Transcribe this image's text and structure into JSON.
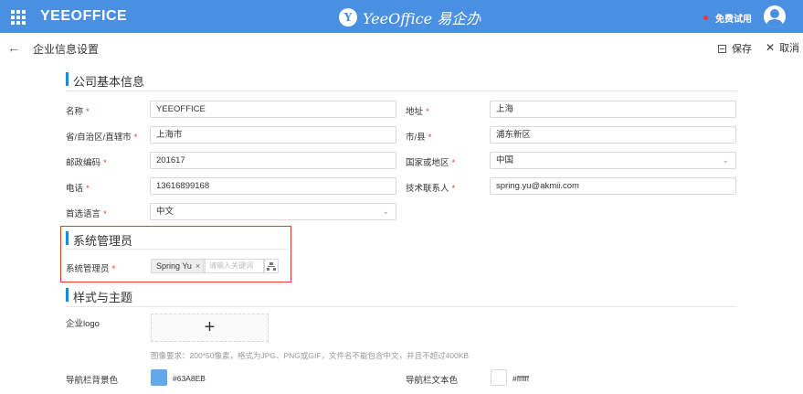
{
  "topbar": {
    "brand": "YEEOFFICE",
    "logo_mark": "Y",
    "logo_text": "YeeOffice 易企办",
    "trial": "免费试用",
    "bg_color": "#4a90e2"
  },
  "subbar": {
    "title": "企业信息设置",
    "save": "保存",
    "cancel": "取消"
  },
  "sections": {
    "basic": "公司基本信息",
    "admin": "系统管理员",
    "theme": "样式与主题"
  },
  "form": {
    "name_label": "名称",
    "name_value": "YEEOFFICE",
    "address_label": "地址",
    "address_value": "上海",
    "province_label": "省/自治区/直辖市",
    "province_value": "上海市",
    "city_label": "市/县",
    "city_value": "浦东新区",
    "zip_label": "邮政编码",
    "zip_value": "201617",
    "country_label": "国家或地区",
    "country_value": "中国",
    "phone_label": "电话",
    "phone_value": "13616899168",
    "contact_label": "技术联系人",
    "contact_value": "spring.yu@akmii.com",
    "lang_label": "首选语言",
    "lang_value": "中文",
    "required_mark": "*"
  },
  "admin": {
    "label": "系统管理员",
    "tag": "Spring Yu",
    "tag_remove": "×",
    "placeholder": "请输入关键词"
  },
  "theme": {
    "logo_label": "企业logo",
    "logo_plus": "+",
    "hint": "图像要求：200*50像素，格式为JPG、PNG或GIF，文件名不能包含中文，并且不超过400KB",
    "nav_bg_label": "导航栏背景色",
    "nav_bg_value": "#63A8EB",
    "nav_text_label": "导航栏文本色",
    "nav_text_value": "#ffffff"
  },
  "colors": {
    "accent": "#1e88e5",
    "required": "#e53935",
    "highlight": "#e53935",
    "swatch_nav_bg": "#63A8EB",
    "swatch_nav_text": "#ffffff"
  }
}
